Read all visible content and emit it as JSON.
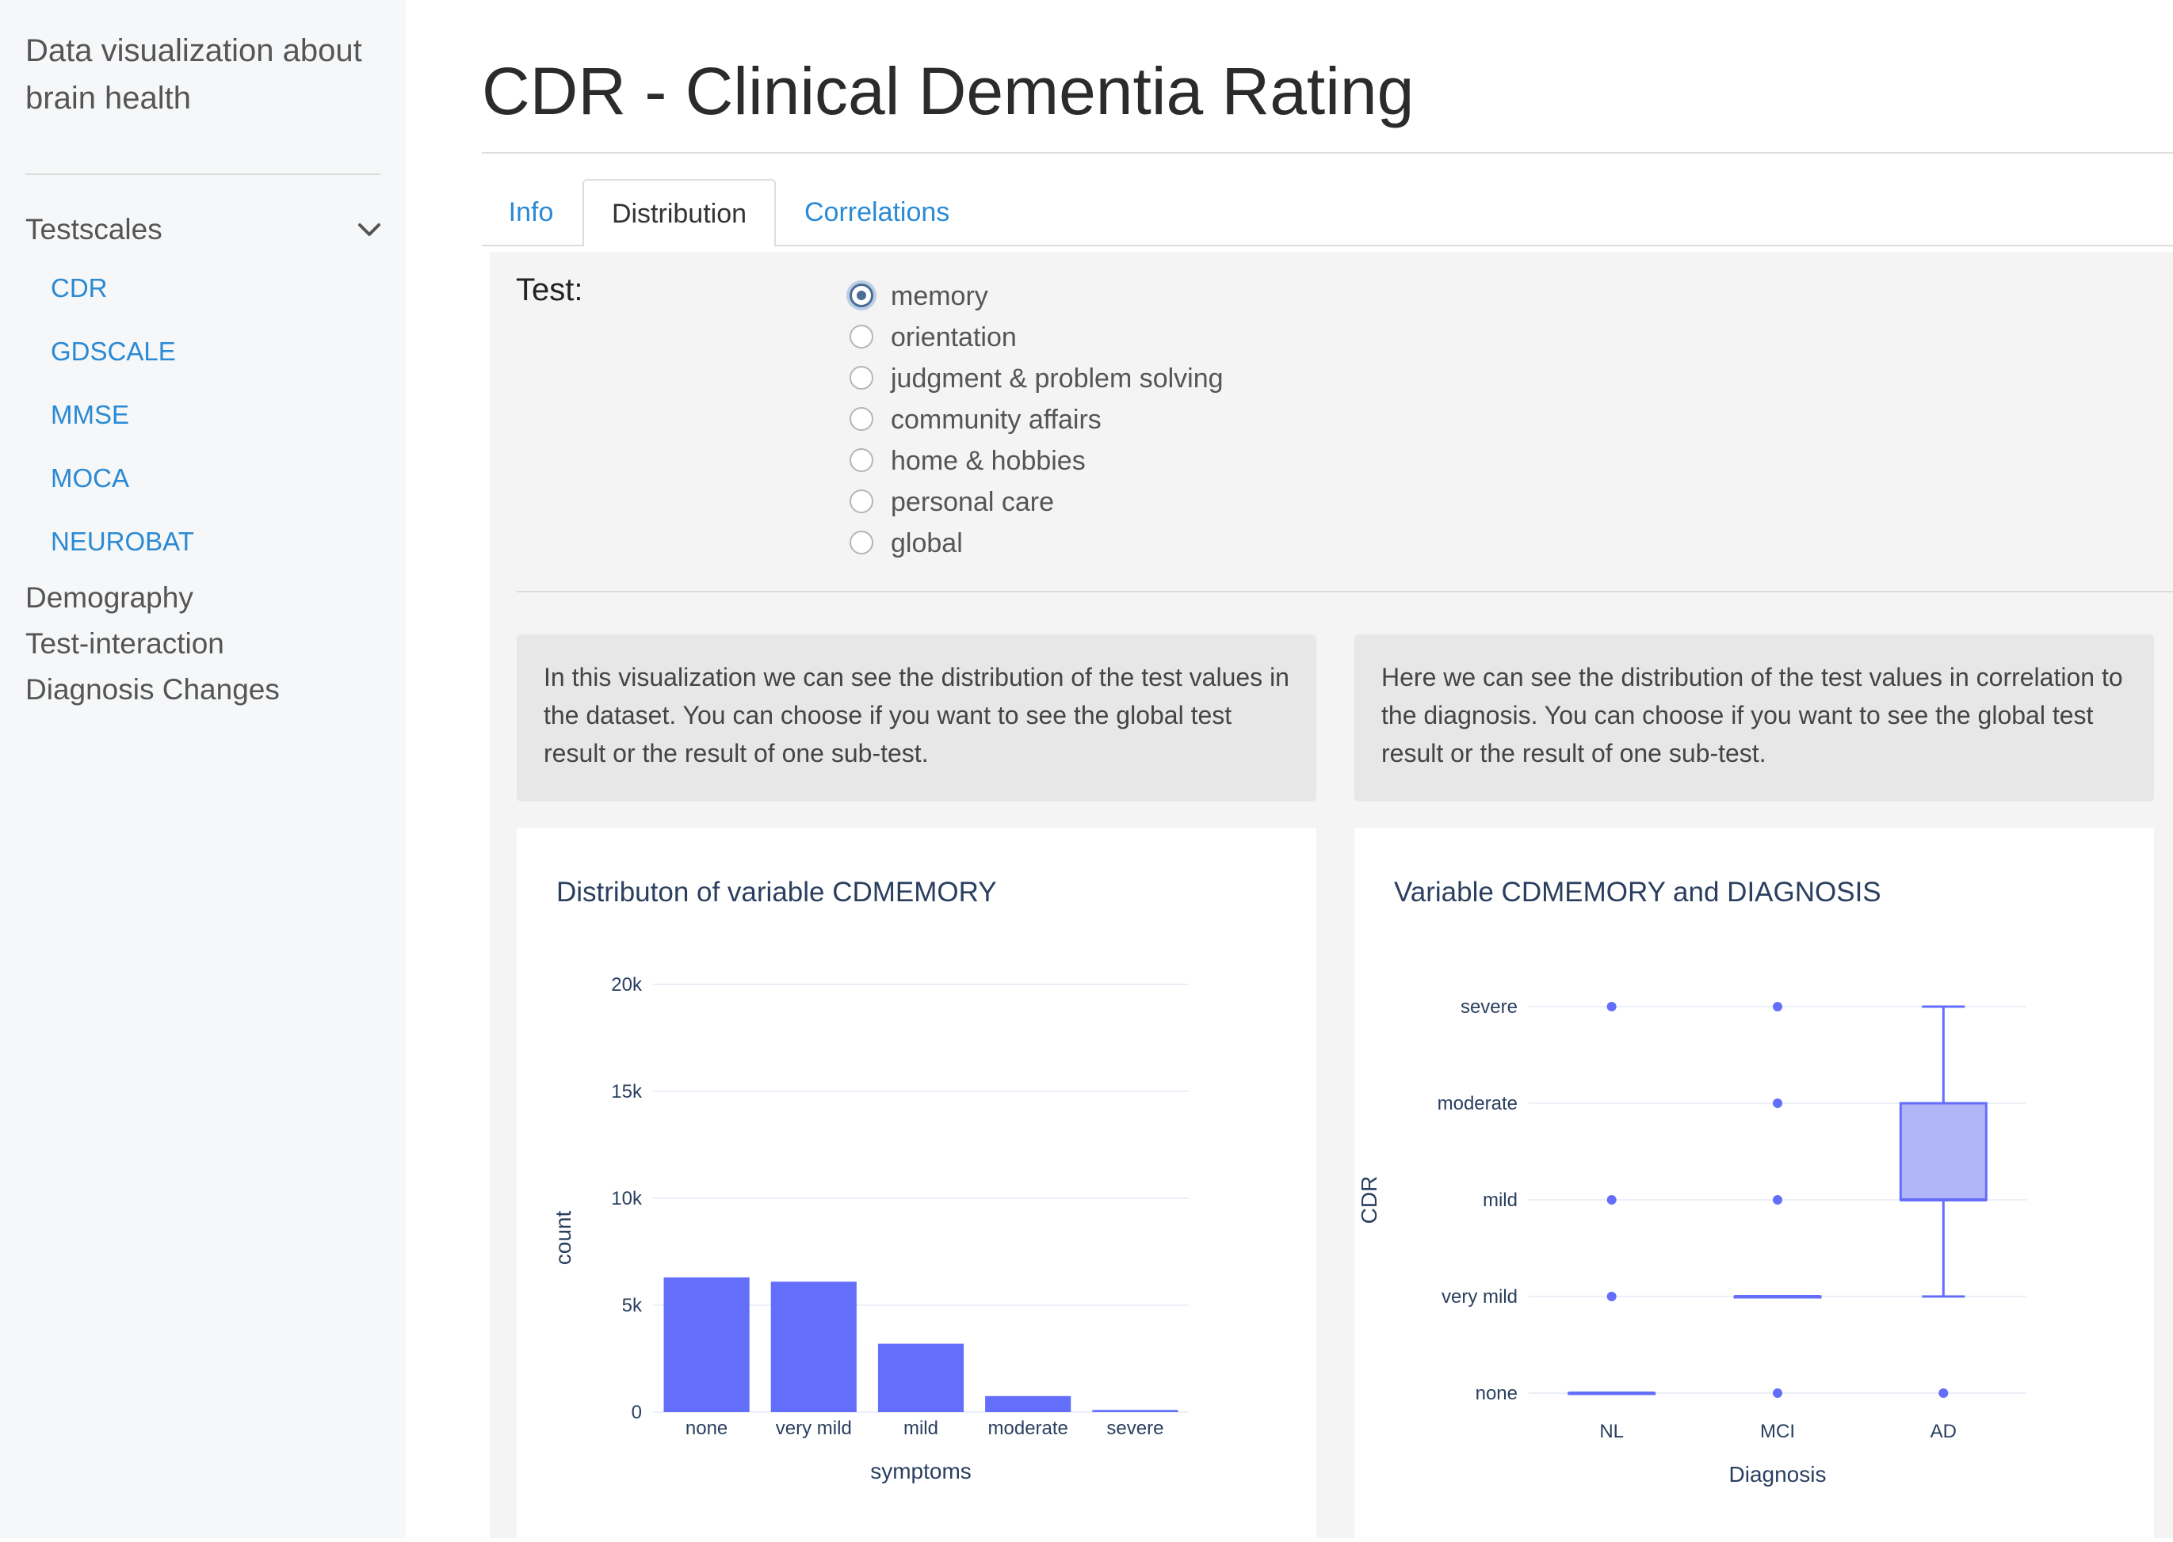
{
  "sidebar": {
    "brand": "Data visualization about brain health",
    "section_title": "Testscales",
    "sub_items": [
      {
        "label": "CDR"
      },
      {
        "label": "GDSCALE"
      },
      {
        "label": "MMSE"
      },
      {
        "label": "MOCA"
      },
      {
        "label": "NEUROBAT"
      }
    ],
    "items": [
      {
        "label": "Demography"
      },
      {
        "label": "Test-interaction"
      },
      {
        "label": "Diagnosis Changes"
      }
    ]
  },
  "page": {
    "title": "CDR - Clinical Dementia Rating"
  },
  "tabs": [
    {
      "label": "Info",
      "active": false
    },
    {
      "label": "Distribution",
      "active": true
    },
    {
      "label": "Correlations",
      "active": false
    }
  ],
  "test_selector": {
    "label": "Test:",
    "selected": "memory",
    "options": [
      {
        "label": "memory",
        "checked": true
      },
      {
        "label": "orientation",
        "checked": false
      },
      {
        "label": "judgment & problem solving",
        "checked": false
      },
      {
        "label": "community affairs",
        "checked": false
      },
      {
        "label": "home & hobbies",
        "checked": false
      },
      {
        "label": "personal care",
        "checked": false
      },
      {
        "label": "global",
        "checked": false
      }
    ]
  },
  "descriptions": {
    "left": "In this visualization we can see the distribution of the test values in the dataset. You can choose if you want to see the global test result or the result of one sub-test.",
    "right": "Here we can see the distribution of the test values in correlation to the diagnosis. You can choose if you want to see the global test result or the result of one sub-test."
  },
  "colors": {
    "accent": "#2a8ad4",
    "bar": "#636efa",
    "box_fill": "#b0b6f7",
    "title": "#2a3f5f"
  },
  "chart_data": [
    {
      "type": "bar",
      "title": "Distributon of variable CDMEMORY",
      "xlabel": "symptoms",
      "ylabel": "count",
      "categories": [
        "none",
        "very mild",
        "mild",
        "moderate",
        "severe"
      ],
      "values": [
        6300,
        6100,
        3200,
        750,
        100
      ],
      "ylim": [
        0,
        20000
      ],
      "yticks": [
        0,
        5000,
        10000,
        15000,
        20000
      ],
      "ytick_labels": [
        "0",
        "5k",
        "10k",
        "15k",
        "20k"
      ],
      "grid": true,
      "legend": "none"
    },
    {
      "type": "box",
      "title": "Variable CDMEMORY and DIAGNOSIS",
      "xlabel": "Diagnosis",
      "ylabel": "CDR",
      "categories": [
        "NL",
        "MCI",
        "AD"
      ],
      "y_levels": [
        "none",
        "very mild",
        "mild",
        "moderate",
        "severe"
      ],
      "boxes": [
        {
          "name": "NL",
          "min": "none",
          "q1": "none",
          "median": "none",
          "q3": "none",
          "max": "none",
          "outliers": [
            "very mild",
            "mild",
            "severe"
          ]
        },
        {
          "name": "MCI",
          "min": "very mild",
          "q1": "very mild",
          "median": "very mild",
          "q3": "very mild",
          "max": "very mild",
          "outliers": [
            "none",
            "mild",
            "moderate",
            "severe"
          ]
        },
        {
          "name": "AD",
          "min": "very mild",
          "q1": "mild",
          "median": "mild",
          "q3": "moderate",
          "max": "severe",
          "outliers": [
            "none"
          ]
        }
      ],
      "grid": true,
      "legend": "none"
    }
  ]
}
